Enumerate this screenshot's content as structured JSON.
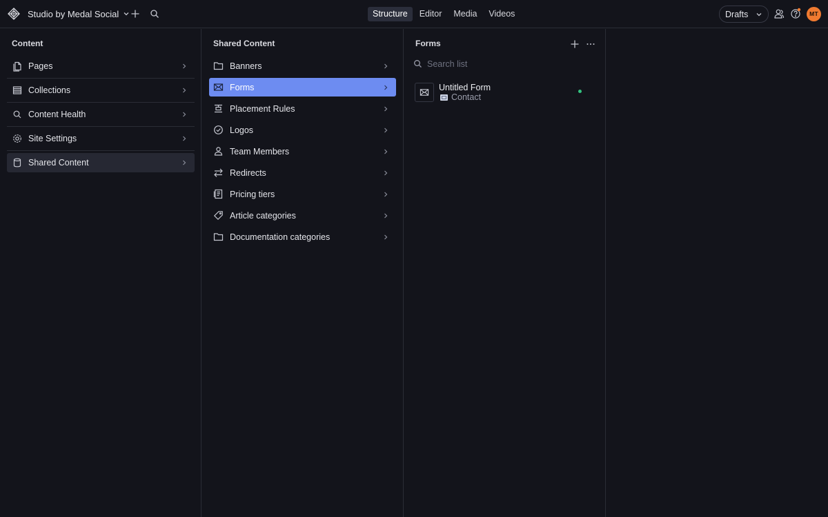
{
  "topbar": {
    "workspace_name": "Studio by Medal Social",
    "tabs": [
      {
        "label": "Structure",
        "active": true
      },
      {
        "label": "Editor",
        "active": false
      },
      {
        "label": "Media",
        "active": false
      },
      {
        "label": "Videos",
        "active": false
      }
    ],
    "drafts_label": "Drafts",
    "avatar_initials": "MT",
    "avatar_color": "#f07a30"
  },
  "content_pane": {
    "title": "Content",
    "items": [
      {
        "label": "Pages",
        "icon": "pages-icon"
      },
      {
        "label": "Collections",
        "icon": "list-icon"
      },
      {
        "label": "Content Health",
        "icon": "search-icon"
      },
      {
        "label": "Site Settings",
        "icon": "gear-icon"
      },
      {
        "label": "Shared Content",
        "icon": "database-icon",
        "selected": true
      }
    ]
  },
  "shared_pane": {
    "title": "Shared Content",
    "items": [
      {
        "label": "Banners",
        "icon": "folder-icon"
      },
      {
        "label": "Forms",
        "icon": "envelope-icon",
        "active": true
      },
      {
        "label": "Placement Rules",
        "icon": "align-icon"
      },
      {
        "label": "Logos",
        "icon": "check-circle-icon"
      },
      {
        "label": "Team Members",
        "icon": "person-icon"
      },
      {
        "label": "Redirects",
        "icon": "arrows-icon"
      },
      {
        "label": "Pricing tiers",
        "icon": "receipt-icon"
      },
      {
        "label": "Article categories",
        "icon": "tag-icon"
      },
      {
        "label": "Documentation categories",
        "icon": "folder-icon"
      }
    ]
  },
  "forms_pane": {
    "title": "Forms",
    "search_placeholder": "Search list",
    "documents": [
      {
        "title": "Untitled Form",
        "subtitle": "Contact",
        "status_color": "#33c27f"
      }
    ]
  },
  "colors": {
    "background": "#13141b",
    "active_item": "#6d8cf1",
    "selected_item": "#262833",
    "border": "#2b2d36"
  }
}
